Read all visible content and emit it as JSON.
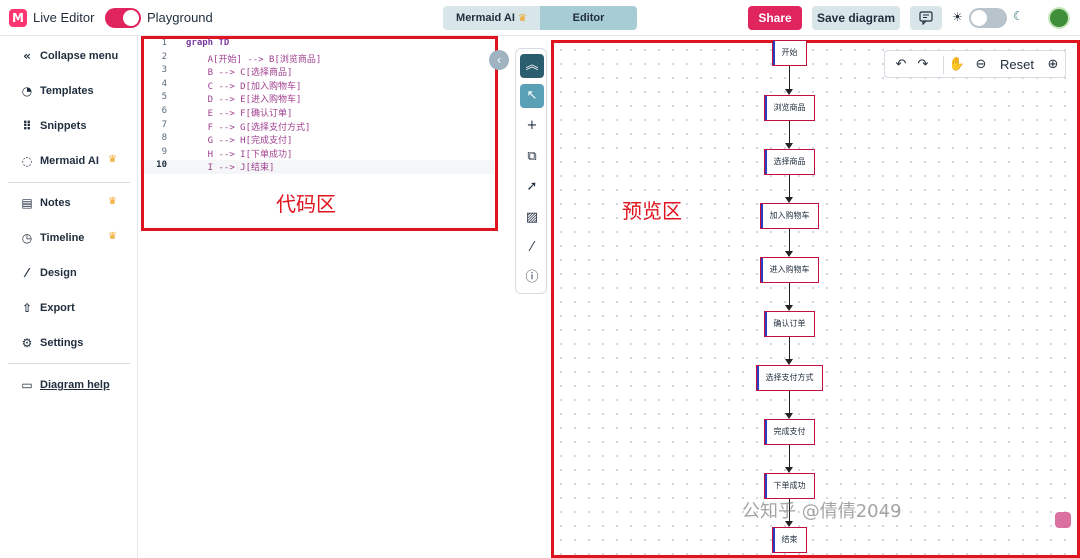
{
  "header": {
    "logo_letter": "M",
    "app_title": "Live Editor",
    "playground_label": "Playground",
    "tabs": [
      {
        "label": "Mermaid AI"
      },
      {
        "label": "Editor"
      }
    ],
    "share_label": "Share",
    "save_label": "Save diagram",
    "accent_color": "#e0245e"
  },
  "sidebar": {
    "items": [
      {
        "label": "Collapse menu",
        "icon": "double-chevron-left-icon"
      },
      {
        "label": "Templates",
        "icon": "templates-icon"
      },
      {
        "label": "Snippets",
        "icon": "snippets-icon"
      },
      {
        "label": "Mermaid AI",
        "icon": "chat-icon",
        "premium": true
      },
      {
        "label": "Notes",
        "icon": "notes-icon",
        "premium": true
      },
      {
        "label": "Timeline",
        "icon": "clock-icon",
        "premium": true
      },
      {
        "label": "Design",
        "icon": "brush-icon"
      },
      {
        "label": "Export",
        "icon": "export-icon"
      },
      {
        "label": "Settings",
        "icon": "gear-icon"
      },
      {
        "label": "Diagram help",
        "icon": "book-icon"
      }
    ]
  },
  "editor": {
    "lines": [
      {
        "n": "1",
        "text": "graph TD"
      },
      {
        "n": "2",
        "text": "    A[开始] --> B[浏览商品]"
      },
      {
        "n": "3",
        "text": "    B --> C[选择商品]"
      },
      {
        "n": "4",
        "text": "    C --> D[加入购物车]"
      },
      {
        "n": "5",
        "text": "    D --> E[进入购物车]"
      },
      {
        "n": "6",
        "text": "    E --> F[确认订单]"
      },
      {
        "n": "7",
        "text": "    F --> G[选择支付方式]"
      },
      {
        "n": "8",
        "text": "    G --> H[完成支付]"
      },
      {
        "n": "9",
        "text": "    H --> I[下单成功]"
      },
      {
        "n": "10",
        "text": "    I --> J[结束]"
      }
    ],
    "annotation": "代码区"
  },
  "preview": {
    "annotation": "预览区",
    "reset_label": "Reset",
    "nodes": [
      "开始",
      "浏览商品",
      "选择商品",
      "加入购物车",
      "进入购物车",
      "确认订单",
      "选择支付方式",
      "完成支付",
      "下单成功",
      "结束"
    ]
  },
  "watermark": "公知乎 @倩倩2049"
}
